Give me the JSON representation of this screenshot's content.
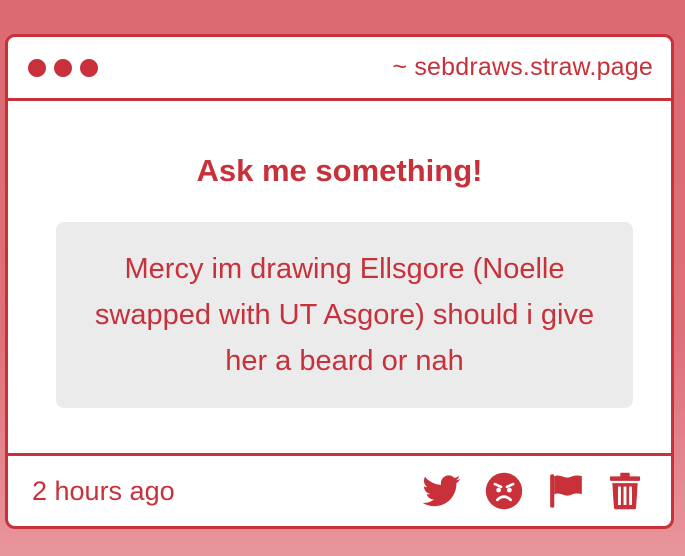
{
  "window": {
    "url": "~ sebdraws.straw.page"
  },
  "main": {
    "heading": "Ask me something!",
    "question": "Mercy im drawing Ellsgore (Noelle swapped with UT Asgore) should i give her a beard or nah"
  },
  "footer": {
    "timestamp": "2 hours ago",
    "actions": [
      {
        "icon": "twitter-icon"
      },
      {
        "icon": "angry-face-icon"
      },
      {
        "icon": "flag-icon"
      },
      {
        "icon": "trash-icon"
      }
    ]
  },
  "colors": {
    "accent": "#c8303a",
    "background": "#dc6a72",
    "question_bg": "#ecebec"
  }
}
